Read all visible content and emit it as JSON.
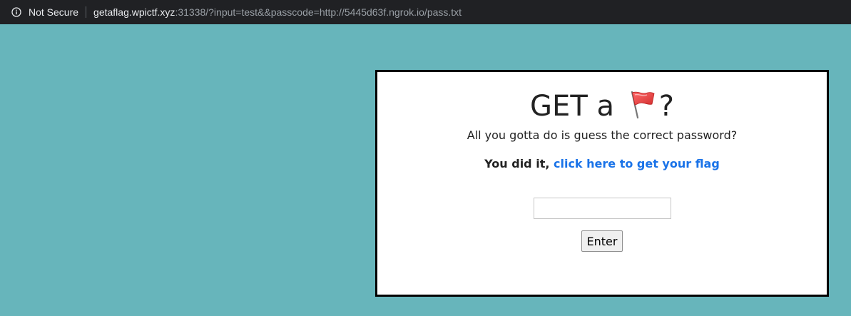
{
  "browser": {
    "security_label": "Not Secure",
    "url_host": "getaflag.wpictf.xyz",
    "url_rest": ":31338/?input=test&&passcode=http://5445d63f.ngrok.io/pass.txt"
  },
  "page": {
    "heading_prefix": "GET a ",
    "heading_suffix": "?",
    "heading_icon": "red-flag-icon",
    "subtitle": "All you gotta do is guess the correct password?",
    "success_text": "You did it, ",
    "link_text": "click here to get your flag",
    "password_value": "",
    "enter_label": "Enter"
  },
  "colors": {
    "background": "#67b5bb",
    "link": "#1a73e8",
    "panel_border": "#000000",
    "flag": "#e53935"
  }
}
